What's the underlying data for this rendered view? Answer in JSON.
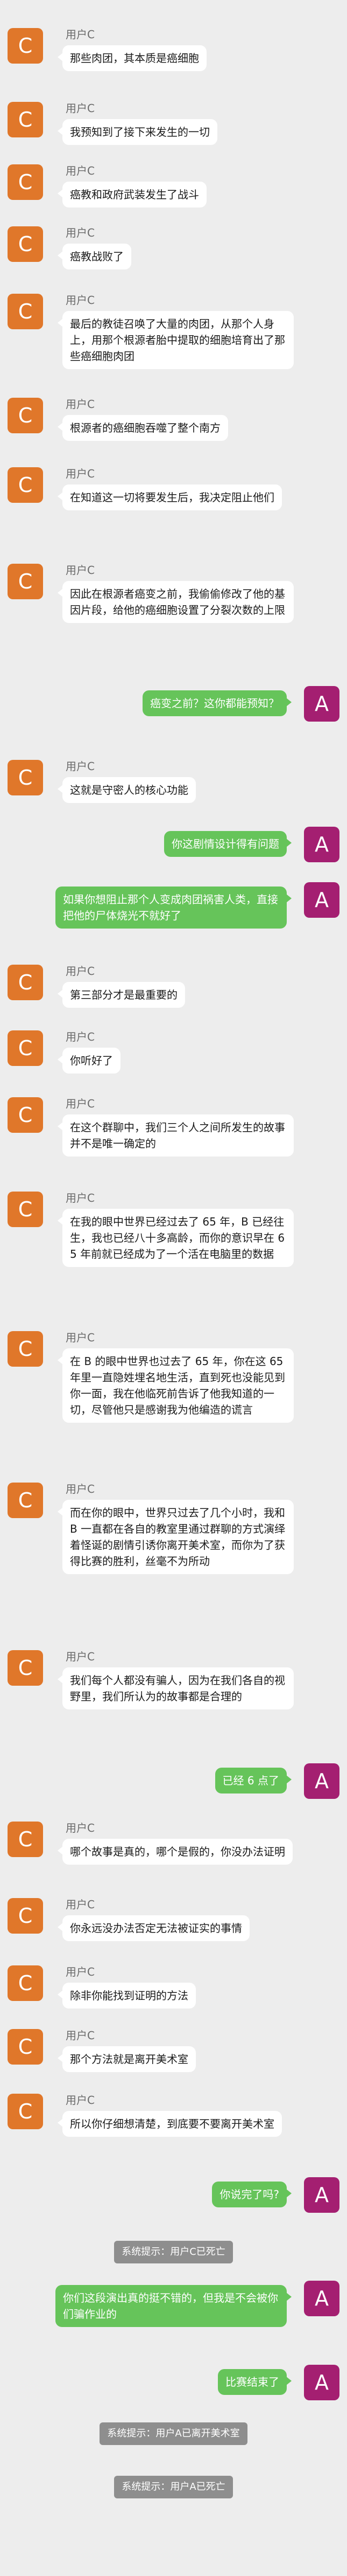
{
  "chat": {
    "messages": [
      {
        "side": "left",
        "avatar": "C",
        "sender": "用户C",
        "text": "那些肉团，其本质是癌细胞"
      },
      {
        "side": "left",
        "avatar": "C",
        "sender": "用户C",
        "text": "我预知到了接下来发生的一切"
      },
      {
        "side": "left",
        "avatar": "C",
        "sender": "用户C",
        "text": "癌教和政府武装发生了战斗"
      },
      {
        "side": "left",
        "avatar": "C",
        "sender": "用户C",
        "text": "癌教战败了"
      },
      {
        "side": "left",
        "avatar": "C",
        "sender": "用户C",
        "text": "最后的教徒召唤了大量的肉团，从那个人身上，用那个根源者胎中提取的细胞培育出了那些癌细胞肉团"
      },
      {
        "side": "left",
        "avatar": "C",
        "sender": "用户C",
        "text": "根源者的癌细胞吞噬了整个南方"
      },
      {
        "side": "left",
        "avatar": "C",
        "sender": "用户C",
        "text": "在知道这一切将要发生后，我决定阻止他们"
      },
      {
        "side": "left",
        "avatar": "C",
        "sender": "用户C",
        "text": "因此在根源者癌变之前，我偷偷修改了他的基因片段，给他的癌细胞设置了分裂次数的上限"
      },
      {
        "side": "right",
        "avatar": "A",
        "sender": "",
        "text": "癌变之前？这你都能预知？"
      },
      {
        "side": "left",
        "avatar": "C",
        "sender": "用户C",
        "text": "这就是守密人的核心功能"
      },
      {
        "side": "right",
        "avatar": "A",
        "sender": "",
        "text": "你这剧情设计得有问题"
      },
      {
        "side": "right",
        "avatar": "A",
        "sender": "",
        "text": "如果你想阻止那个人变成肉团祸害人类，直接把他的尸体烧光不就好了"
      },
      {
        "side": "left",
        "avatar": "C",
        "sender": "用户C",
        "text": "第三部分才是最重要的"
      },
      {
        "side": "left",
        "avatar": "C",
        "sender": "用户C",
        "text": "你听好了"
      },
      {
        "side": "left",
        "avatar": "C",
        "sender": "用户C",
        "text": "在这个群聊中，我们三个人之间所发生的故事并不是唯一确定的"
      },
      {
        "side": "left",
        "avatar": "C",
        "sender": "用户C",
        "text": "在我的眼中世界已经过去了 65 年，B 已经往生，我也已经八十多高龄，而你的意识早在 65 年前就已经成为了一个活在电脑里的数据"
      },
      {
        "side": "left",
        "avatar": "C",
        "sender": "用户C",
        "text": "在 B 的眼中世界也过去了 65 年，你在这 65 年里一直隐姓埋名地生活，直到死也没能见到你一面，我在他临死前告诉了他我知道的一切，尽管他只是感谢我为他编造的谎言"
      },
      {
        "side": "left",
        "avatar": "C",
        "sender": "用户C",
        "text": "而在你的眼中，世界只过去了几个小时，我和 B 一直都在各自的教室里通过群聊的方式演绎着怪诞的剧情引诱你离开美术室，而你为了获得比赛的胜利，丝毫不为所动"
      },
      {
        "side": "left",
        "avatar": "C",
        "sender": "用户C",
        "text": "我们每个人都没有骗人，因为在我们各自的视野里，我们所认为的故事都是合理的"
      },
      {
        "side": "right",
        "avatar": "A",
        "sender": "",
        "text": "已经 6 点了"
      },
      {
        "side": "left",
        "avatar": "C",
        "sender": "用户C",
        "text": "哪个故事是真的，哪个是假的，你没办法证明"
      },
      {
        "side": "left",
        "avatar": "C",
        "sender": "用户C",
        "text": "你永远没办法否定无法被证实的事情"
      },
      {
        "side": "left",
        "avatar": "C",
        "sender": "用户C",
        "text": "除非你能找到证明的方法"
      },
      {
        "side": "left",
        "avatar": "C",
        "sender": "用户C",
        "text": "那个方法就是离开美术室"
      },
      {
        "side": "left",
        "avatar": "C",
        "sender": "用户C",
        "text": "所以你仔细想清楚，到底要不要离开美术室"
      },
      {
        "side": "right",
        "avatar": "A",
        "sender": "",
        "text": "你说完了吗?"
      },
      {
        "side": "system",
        "text": "系统提示：用户C已死亡"
      },
      {
        "side": "right",
        "avatar": "A",
        "sender": "",
        "text": "你们这段演出真的挺不错的，但我是不会被你们骗作业的"
      },
      {
        "side": "right",
        "avatar": "A",
        "sender": "",
        "text": "比赛结束了"
      },
      {
        "side": "system",
        "text": "系统提示：用户A已离开美术室"
      },
      {
        "side": "system",
        "text": "系统提示：用户A已死亡"
      }
    ]
  }
}
